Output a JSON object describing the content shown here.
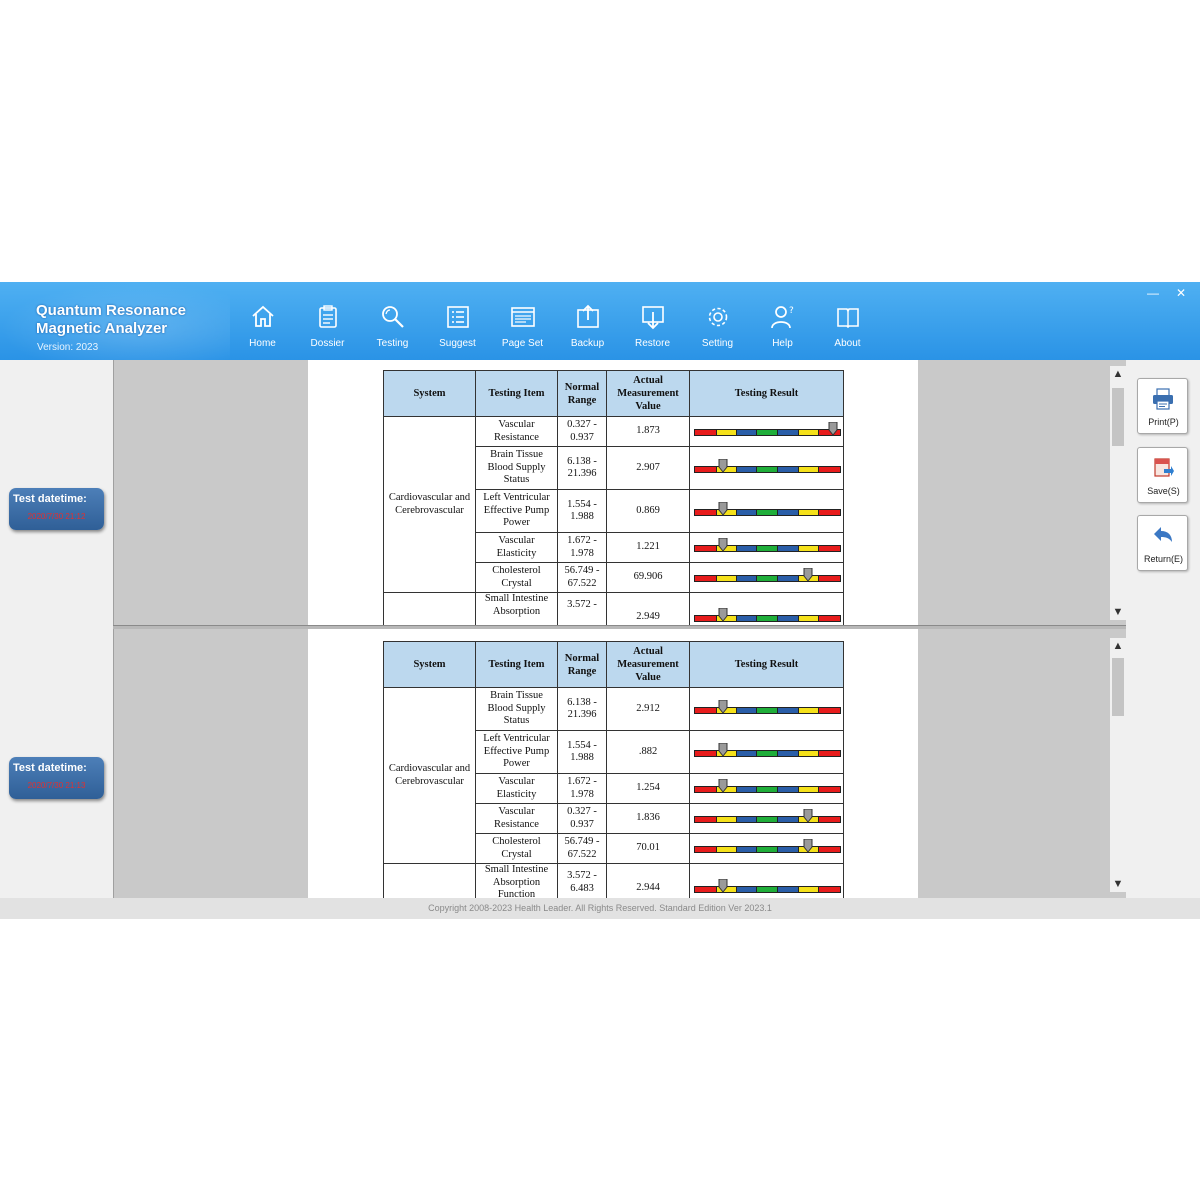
{
  "app": {
    "title_line1": "Quantum Resonance",
    "title_line2": "Magnetic Analyzer",
    "version": "Version: 2023",
    "window_controls": {
      "minimize": "—",
      "close": "✕"
    }
  },
  "nav": [
    {
      "label": "Home",
      "icon": "home-icon"
    },
    {
      "label": "Dossier",
      "icon": "clipboard-icon"
    },
    {
      "label": "Testing",
      "icon": "magnifier-icon"
    },
    {
      "label": "Suggest",
      "icon": "list-icon"
    },
    {
      "label": "Page Set",
      "icon": "page-layout-icon"
    },
    {
      "label": "Backup",
      "icon": "upload-icon"
    },
    {
      "label": "Restore",
      "icon": "download-icon"
    },
    {
      "label": "Setting",
      "icon": "gear-icon"
    },
    {
      "label": "Help",
      "icon": "help-user-icon"
    },
    {
      "label": "About",
      "icon": "book-icon"
    }
  ],
  "reports": [
    {
      "datetime_label": "Test datetime:",
      "datetime_value": "2020/7/30 21:12"
    },
    {
      "datetime_label": "Test datetime:",
      "datetime_value": "2020/7/30 21:13"
    }
  ],
  "table_headers": {
    "system": "System",
    "item": "Testing Item",
    "range_l1": "Normal",
    "range_l2": "Range",
    "value_l1": "Actual",
    "value_l2": "Measurement",
    "value_l3": "Value",
    "result": "Testing Result"
  },
  "report1": {
    "system_l1": "Cardiovascular and",
    "system_l2": "Cerebrovascular",
    "rows": [
      {
        "item": [
          "Vascular",
          "Resistance"
        ],
        "range": [
          "0.327 -",
          "0.937"
        ],
        "value": "1.873",
        "level": 0.95
      },
      {
        "item": [
          "Brain Tissue",
          "Blood Supply",
          "Status"
        ],
        "range": [
          "6.138 -",
          "21.396"
        ],
        "value": "2.907",
        "level": 0.2
      },
      {
        "item": [
          "Left Ventricular",
          "Effective Pump",
          "Power"
        ],
        "range": [
          "1.554 -",
          "1.988"
        ],
        "value": "0.869",
        "level": 0.2
      },
      {
        "item": [
          "Vascular",
          "Elasticity"
        ],
        "range": [
          "1.672 -",
          "1.978"
        ],
        "value": "1.221",
        "level": 0.2
      },
      {
        "item": [
          "Cholesterol",
          "Crystal"
        ],
        "range": [
          "56.749 -",
          "67.522"
        ],
        "value": "69.906",
        "level": 0.78
      }
    ],
    "partial": {
      "item": [
        "Small Intestine",
        "Absorption"
      ],
      "range": [
        "3.572 -"
      ],
      "value": "2.949",
      "level": 0.2
    }
  },
  "report2": {
    "system_l1": "Cardiovascular and",
    "system_l2": "Cerebrovascular",
    "rows": [
      {
        "item": [
          "Brain Tissue",
          "Blood Supply",
          "Status"
        ],
        "range": [
          "6.138 -",
          "21.396"
        ],
        "value": "2.912",
        "level": 0.2
      },
      {
        "item": [
          "Left Ventricular",
          "Effective Pump",
          "Power"
        ],
        "range": [
          "1.554 -",
          "1.988"
        ],
        "value": ".882",
        "level": 0.2
      },
      {
        "item": [
          "Vascular",
          "Elasticity"
        ],
        "range": [
          "1.672 -",
          "1.978"
        ],
        "value": "1.254",
        "level": 0.2
      },
      {
        "item": [
          "Vascular",
          "Resistance"
        ],
        "range": [
          "0.327 -",
          "0.937"
        ],
        "value": "1.836",
        "level": 0.78
      },
      {
        "item": [
          "Cholesterol",
          "Crystal"
        ],
        "range": [
          "56.749 -",
          "67.522"
        ],
        "value": "70.01",
        "level": 0.78
      }
    ],
    "partial": {
      "item": [
        "Small Intestine",
        "Absorption",
        "Function"
      ],
      "range": [
        "3.572 -",
        "6.483"
      ],
      "value": "2.944",
      "level": 0.2
    }
  },
  "gauge_colors": [
    "#e81c1c",
    "#f5e11a",
    "#2a5ea8",
    "#1fae3a",
    "#2a5ea8",
    "#f5e11a",
    "#e81c1c"
  ],
  "actions": {
    "print": "Print(P)",
    "save": "Save(S)",
    "return": "Return(E)"
  },
  "footer": "Copyright 2008-2023 Health Leader. All Rights Reserved.  Standard Edition Ver 2023.1"
}
